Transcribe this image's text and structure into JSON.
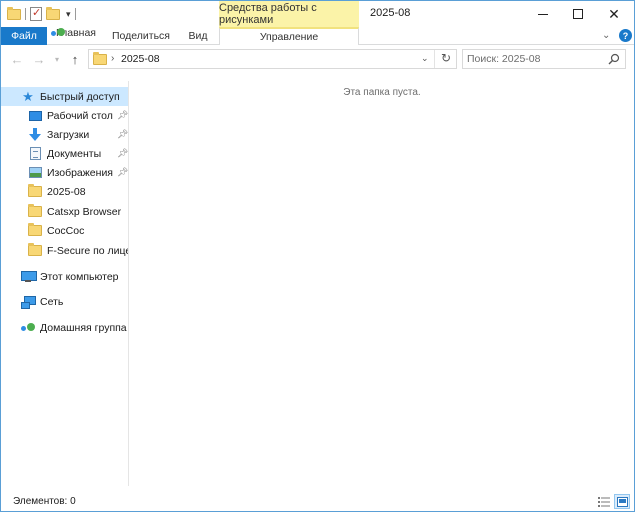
{
  "window": {
    "title": "2025-08",
    "context_tab_group": "Средства работы с рисунками"
  },
  "ribbon": {
    "tabs": [
      "Файл",
      "Главная",
      "Поделиться",
      "Вид",
      "Управление"
    ]
  },
  "address_bar": {
    "path": "2025-08",
    "search_placeholder": "Поиск: 2025-08"
  },
  "navigation_pane": {
    "quick_access": {
      "label": "Быстрый доступ",
      "items": [
        {
          "label": "Рабочий стол",
          "icon": "desktop-icon",
          "pinned": true
        },
        {
          "label": "Загрузки",
          "icon": "downloads-icon",
          "pinned": true
        },
        {
          "label": "Документы",
          "icon": "documents-icon",
          "pinned": true
        },
        {
          "label": "Изображения",
          "icon": "pictures-icon",
          "pinned": true
        },
        {
          "label": "2025-08",
          "icon": "folder-icon",
          "pinned": false
        },
        {
          "label": "Catsxp Browser",
          "icon": "folder-icon",
          "pinned": false
        },
        {
          "label": "CocCoc",
          "icon": "folder-icon",
          "pinned": false
        },
        {
          "label": "F-Secure по лиценз",
          "icon": "folder-icon",
          "pinned": false
        }
      ]
    },
    "this_pc": "Этот компьютер",
    "network": "Сеть",
    "homegroup": "Домашняя группа"
  },
  "content": {
    "empty_message": "Эта папка пуста."
  },
  "status_bar": {
    "item_count": "Элементов: 0"
  },
  "colors": {
    "accent": "#1979ca",
    "selection": "#cce8ff",
    "context_tab": "#fbf3a8"
  }
}
